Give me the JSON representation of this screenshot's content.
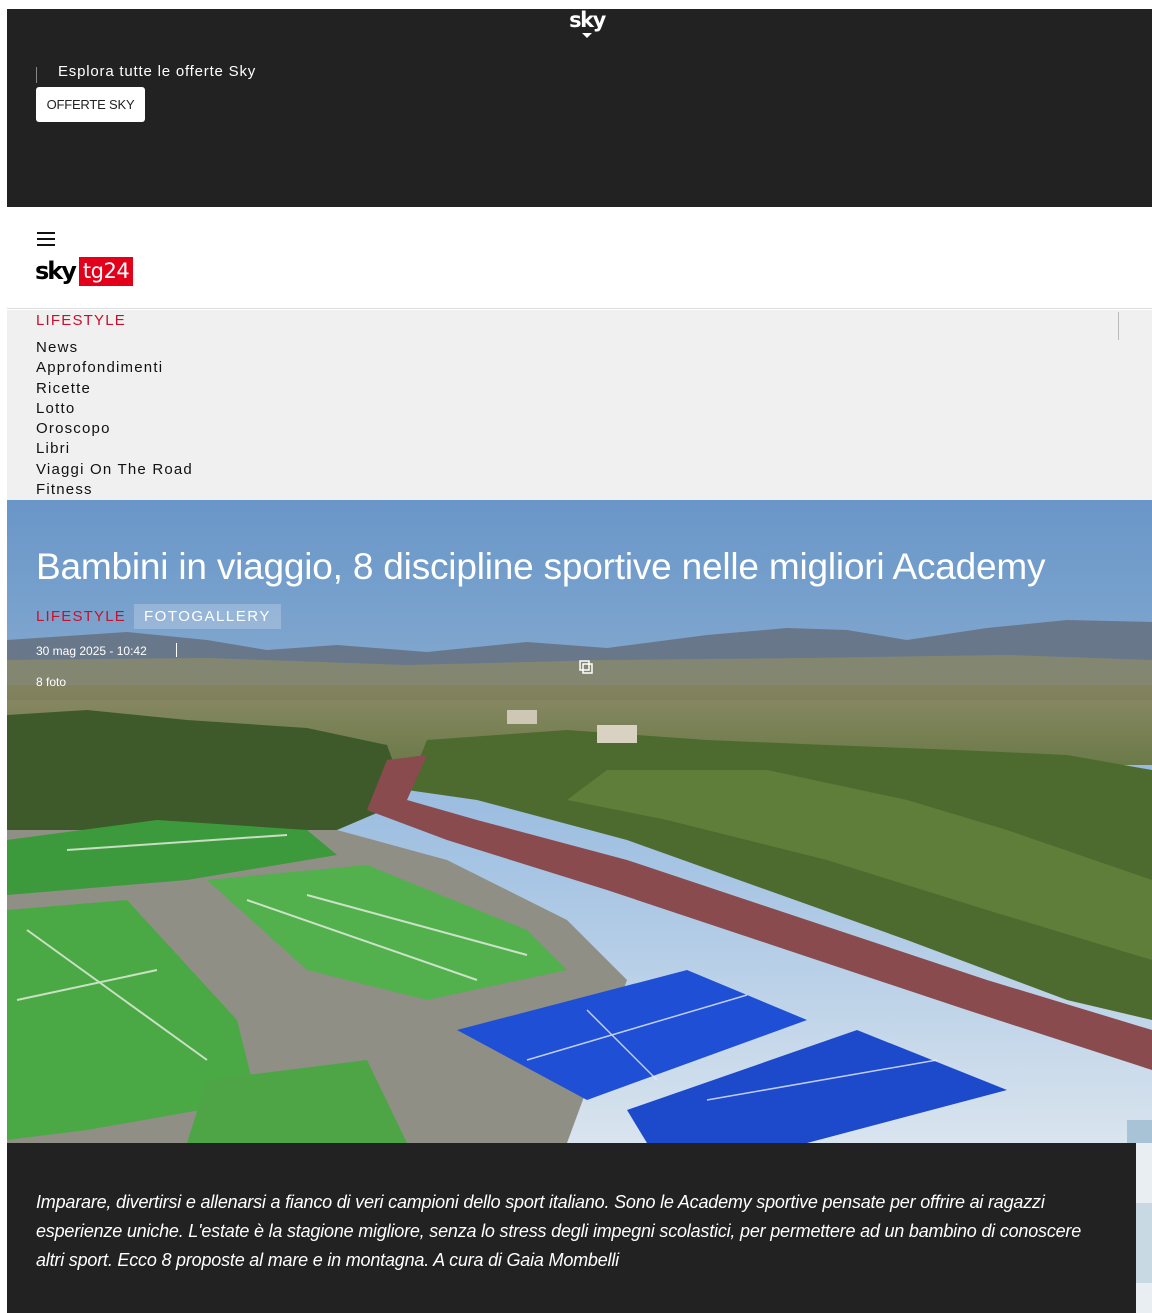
{
  "top_banner": {
    "logo_text": "sky",
    "promo_text": "Esplora tutte le offerte Sky",
    "offer_button_label": "OFFERTE SKY"
  },
  "header": {
    "brand_sky": "sky",
    "brand_tg": "tg24"
  },
  "section_nav": {
    "title": "LIFESTYLE",
    "items": [
      {
        "label": "News"
      },
      {
        "label": "Approfondimenti"
      },
      {
        "label": "Ricette"
      },
      {
        "label": "Lotto"
      },
      {
        "label": "Oroscopo"
      },
      {
        "label": "Libri"
      },
      {
        "label": "Viaggi On The Road"
      },
      {
        "label": "Fitness"
      }
    ]
  },
  "article": {
    "title": "Bambini in viaggio, 8 discipline sportive nelle migliori Academy",
    "category": "LIFESTYLE",
    "type_badge": "FOTOGALLERY",
    "date": "30 mag 2025 - 10:42",
    "photo_count": "8 foto",
    "caption": "Imparare, divertirsi e allenarsi a fianco di veri campioni dello sport italiano. Sono le Academy sportive pensate per offrire ai ragazzi esperienze uniche. L'estate è la stagione migliore, senza lo stress degli impegni scolastici, per permettere ad un bambino di conoscere altri sport. Ecco 8 proposte al mare e in montagna. A cura di Gaia Mombelli"
  },
  "colors": {
    "banner_bg": "#222222",
    "brand_red": "#e3001b",
    "section_red": "#c8102e",
    "nav_bg": "#f0f0f0"
  },
  "icons": [
    "menu-icon",
    "gallery-icon",
    "caret-down-icon"
  ]
}
